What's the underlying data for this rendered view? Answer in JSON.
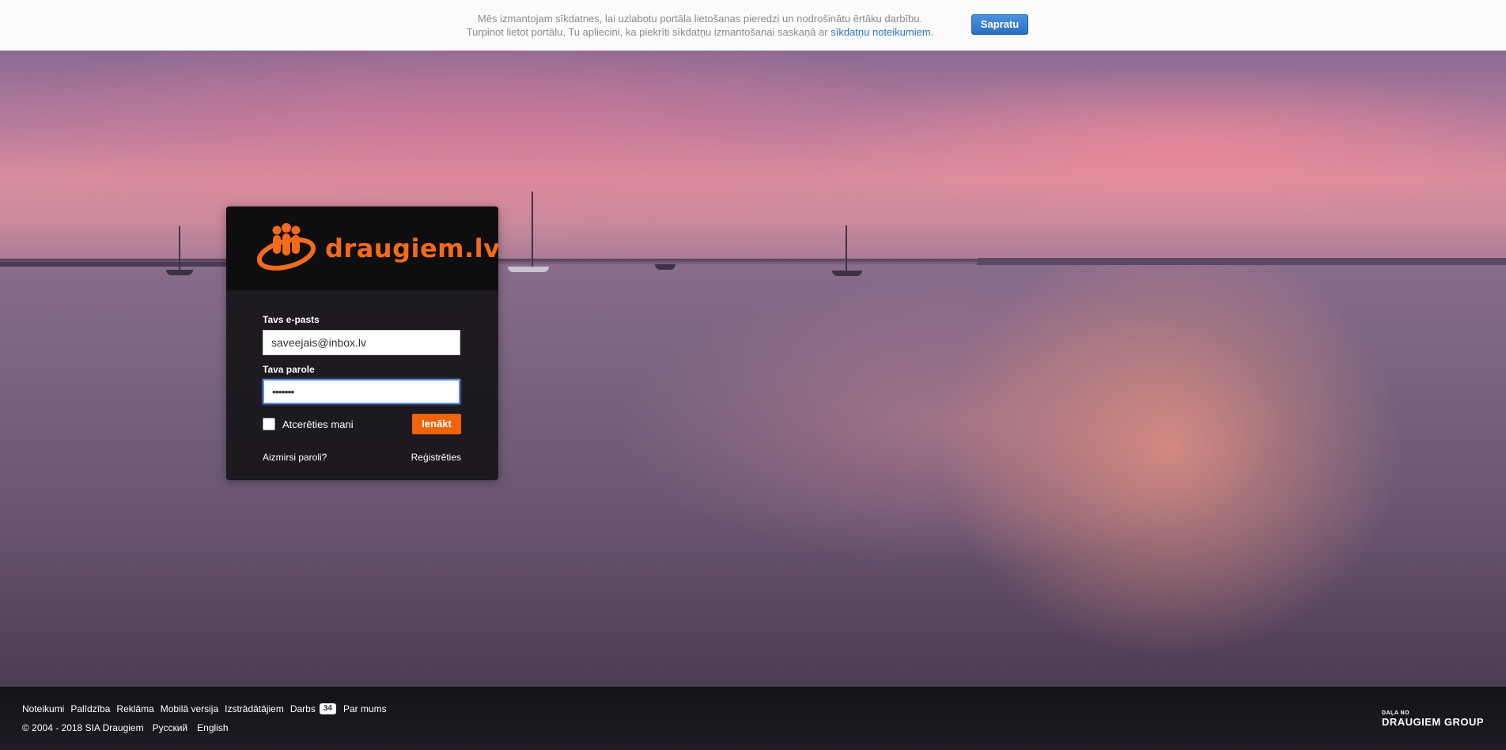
{
  "cookie_bar": {
    "line1": "Mēs izmantojam sīkdatnes, lai uzlabotu portāla lietošanas pieredzi un nodrošinātu ērtāku darbību.",
    "line2_prefix": "Turpinot lietot portālu, Tu apliecini, ka piekrīti sīkdatņu izmantošanai saskaņā ar ",
    "line2_link": "sīkdatņu noteikumiem",
    "line2_suffix": ".",
    "accept_label": "Sapratu",
    "link_color": "#2b74c8"
  },
  "login": {
    "logo_text": "draugiem.lv",
    "brand_color": "#f26a1b",
    "email_label": "Tavs e-pasts",
    "email_value": "saveejais@inbox.lv",
    "password_label": "Tava parole",
    "password_value": "•••••••",
    "remember_label": "Atcerēties mani",
    "submit_label": "Ienākt",
    "forgot_label": "Aizmirsi paroli?",
    "register_label": "Reģistrēties"
  },
  "footer": {
    "links": [
      "Noteikumi",
      "Palīdzība",
      "Reklāma",
      "Mobilā versija",
      "Izstrādātājiem"
    ],
    "jobs_label": "Darbs",
    "jobs_count": "34",
    "about_label": "Par mums",
    "copyright": "© 2004 - 2018 SIA Draugiem",
    "lang_ru": "Русский",
    "lang_en": "English",
    "group_small": "DAĻA NO",
    "group_big": "DRAUGIEM GROUP"
  },
  "icons": {
    "logo": "draugiem-people-logo-icon",
    "checkbox": "checkbox-unchecked-icon"
  }
}
